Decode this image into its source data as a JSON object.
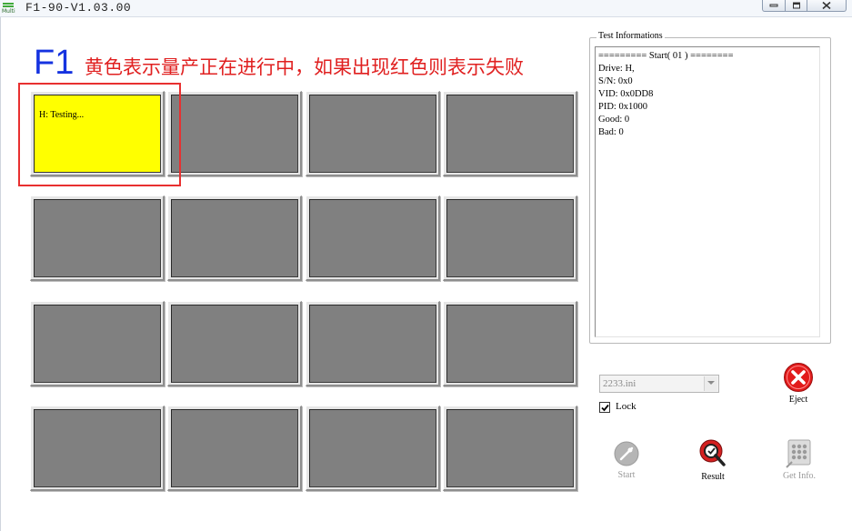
{
  "window": {
    "title": "F1-90-V1.03.00",
    "icon_text": "Multi"
  },
  "heading": {
    "logo": "F1",
    "note": "黄色表示量产正在进行中，如果出现红色则表示失败"
  },
  "slots": [
    {
      "status": "H: Testing...",
      "state": "testing"
    },
    {
      "status": "",
      "state": "idle"
    },
    {
      "status": "",
      "state": "idle"
    },
    {
      "status": "",
      "state": "idle"
    },
    {
      "status": "",
      "state": "idle"
    },
    {
      "status": "",
      "state": "idle"
    },
    {
      "status": "",
      "state": "idle"
    },
    {
      "status": "",
      "state": "idle"
    },
    {
      "status": "",
      "state": "idle"
    },
    {
      "status": "",
      "state": "idle"
    },
    {
      "status": "",
      "state": "idle"
    },
    {
      "status": "",
      "state": "idle"
    },
    {
      "status": "",
      "state": "idle"
    },
    {
      "status": "",
      "state": "idle"
    },
    {
      "status": "",
      "state": "idle"
    },
    {
      "status": "",
      "state": "idle"
    }
  ],
  "colors": {
    "testing": "#ffff00",
    "idle": "#808080",
    "annotation": "#e02020",
    "logo": "#1533e0"
  },
  "test_info": {
    "legend": "Test Informations",
    "lines": [
      "========= Start( 01 ) ========",
      "Drive: H,",
      "S/N: 0x0",
      "VID: 0x0DD8",
      "PID: 0x1000",
      "Good: 0",
      "Bad: 0"
    ]
  },
  "ini_select": {
    "value": "2233.ini"
  },
  "lock": {
    "label": "Lock",
    "checked": true
  },
  "actions": {
    "eject": {
      "label": "Eject",
      "icon": "eject-icon"
    },
    "start": {
      "label": "Start",
      "icon": "start-icon",
      "enabled": false
    },
    "result": {
      "label": "Result",
      "icon": "result-icon"
    },
    "get_info": {
      "label": "Get Info.",
      "icon": "get-info-icon",
      "enabled": false
    }
  }
}
